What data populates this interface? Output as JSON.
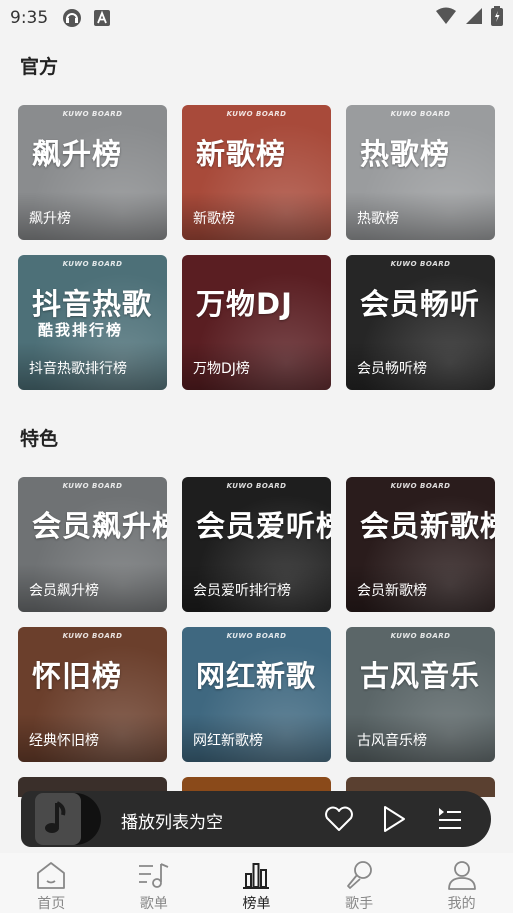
{
  "status": {
    "time": "9:35"
  },
  "sections": [
    {
      "title": "官方"
    },
    {
      "title": "特色"
    }
  ],
  "cards": [
    {
      "brand": "KUWO BOARD",
      "big": "飙升榜",
      "sub": "",
      "label": "飙升榜",
      "bg": "#8a8c8e"
    },
    {
      "brand": "KUWO BOARD",
      "big": "新歌榜",
      "sub": "",
      "label": "新歌榜",
      "bg": "#a84a3a"
    },
    {
      "brand": "KUWO BOARD",
      "big": "热歌榜",
      "sub": "",
      "label": "热歌榜",
      "bg": "#9a9c9e"
    },
    {
      "brand": "KUWO BOARD",
      "big": "抖音热歌",
      "sub": "酷我排行榜",
      "label": "抖音热歌排行榜",
      "bg": "#4d7078"
    },
    {
      "brand": "",
      "big": "万物DJ",
      "sub": "",
      "label": "万物DJ榜",
      "bg": "#5a1e22"
    },
    {
      "brand": "KUWO BOARD",
      "big": "会员畅听",
      "sub": "",
      "label": "会员畅听榜",
      "bg": "#262626"
    },
    {
      "brand": "KUWO BOARD",
      "big": "会员飙升榜",
      "sub": "",
      "label": "会员飙升榜",
      "bg": "#6f7274"
    },
    {
      "brand": "KUWO BOARD",
      "big": "会员爱听榜",
      "sub": "",
      "label": "会员爱听排行榜",
      "bg": "#1e1e1e"
    },
    {
      "brand": "KUWO BOARD",
      "big": "会员新歌榜",
      "sub": "",
      "label": "会员新歌榜",
      "bg": "#2a1c1c"
    },
    {
      "brand": "KUWO BOARD",
      "big": "怀旧榜",
      "sub": "",
      "label": "经典怀旧榜",
      "bg": "#6b3f2c"
    },
    {
      "brand": "KUWO BOARD",
      "big": "网红新歌",
      "sub": "",
      "label": "网红新歌榜",
      "bg": "#3f6880"
    },
    {
      "brand": "KUWO BOARD",
      "big": "古风音乐",
      "sub": "",
      "label": "古风音乐榜",
      "bg": "#5b6668"
    }
  ],
  "player": {
    "text": "播放列表为空"
  },
  "tabs": [
    {
      "label": "首页"
    },
    {
      "label": "歌单"
    },
    {
      "label": "榜单"
    },
    {
      "label": "歌手"
    },
    {
      "label": "我的"
    }
  ],
  "colors": {
    "accent": "#222222",
    "player_bg": "#2b2b2b",
    "inactive": "#888888"
  }
}
